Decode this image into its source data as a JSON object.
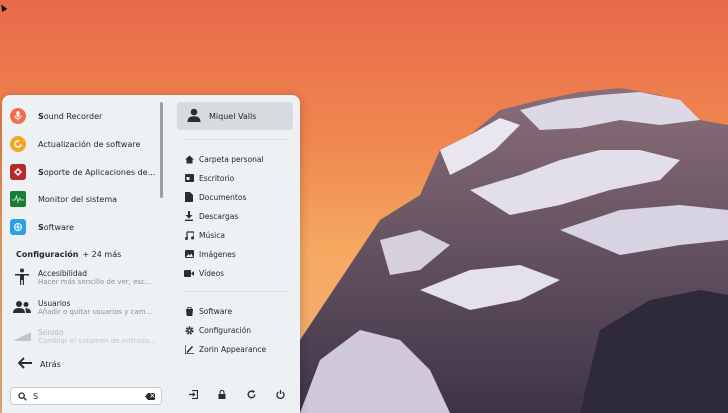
{
  "apps": [
    {
      "label_bold": "S",
      "label_rest": "ound Recorder",
      "icon": "microphone-icon",
      "color": "#f26b4a"
    },
    {
      "label_bold": "",
      "label_rest": "Actualización de software",
      "icon": "update-icon",
      "color": "#f5a623"
    },
    {
      "label_bold": "S",
      "label_rest": "oporte de Aplicaciones de Wi...",
      "icon": "wine-icon",
      "color": "#b52b2b"
    },
    {
      "label_bold": "",
      "label_rest": "Monitor del sistema",
      "icon": "system-monitor-icon",
      "color": "#1c7a3a"
    },
    {
      "label_bold": "S",
      "label_rest": "oftware",
      "icon": "software-icon",
      "color": "#2aa0e6"
    }
  ],
  "settings_section": {
    "title": "Configuración",
    "more": "+ 24 más"
  },
  "settings": [
    {
      "title": "Accesibilidad",
      "desc": "Hacer más sencillo de ver, esc..."
    },
    {
      "title": "Usuarios",
      "desc": "Añadir o quitar usuarios y cam..."
    },
    {
      "title": "Sonido",
      "desc": "Cambiar el volumen de entrada..."
    }
  ],
  "back_label": "Atrás",
  "search": {
    "value": "S"
  },
  "user": {
    "name": "Miquel Valls"
  },
  "places": [
    {
      "label": "Carpeta personal",
      "icon": "home-icon"
    },
    {
      "label": "Escritorio",
      "icon": "desktop-icon"
    },
    {
      "label": "Documentos",
      "icon": "document-icon"
    },
    {
      "label": "Descargas",
      "icon": "download-icon"
    },
    {
      "label": "Música",
      "icon": "music-icon"
    },
    {
      "label": "Imágenes",
      "icon": "image-icon"
    },
    {
      "label": "Vídeos",
      "icon": "video-icon"
    }
  ],
  "system_items": [
    {
      "label": "Software",
      "icon": "software-icon"
    },
    {
      "label": "Configuración",
      "icon": "gear-icon"
    },
    {
      "label": "Zorin Appearance",
      "icon": "appearance-icon"
    }
  ],
  "power_actions": [
    "logout-icon",
    "lock-icon",
    "restart-icon",
    "power-icon"
  ]
}
